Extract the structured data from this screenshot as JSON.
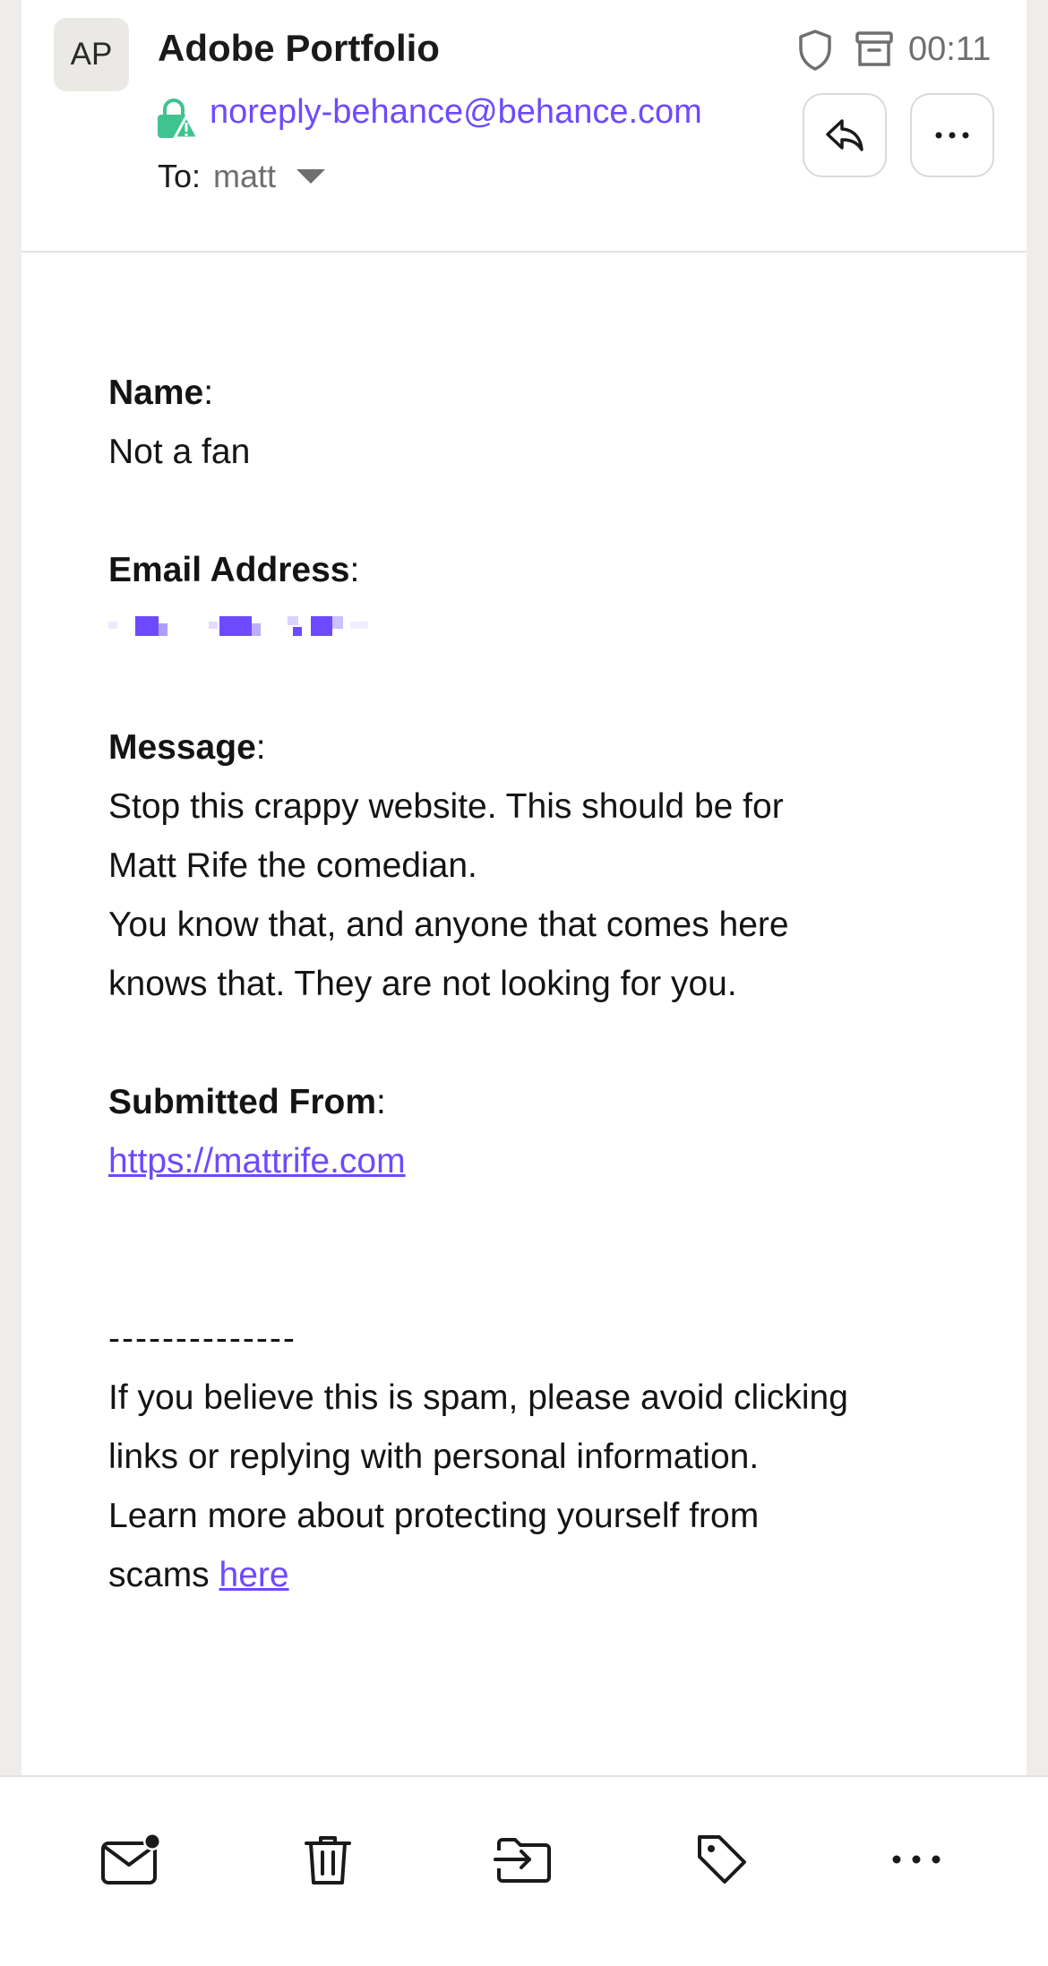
{
  "header": {
    "avatar_initials": "AP",
    "sender_name": "Adobe Portfolio",
    "sender_email": "noreply-behance@behance.com",
    "to_label": "To:",
    "recipient": "matt",
    "time": "00:11"
  },
  "message": {
    "name_label": "Name",
    "name_value": "Not a fan",
    "email_label": "Email Address",
    "message_label": "Message",
    "message_lines": [
      "Stop this crappy website. This should be for",
      "Matt Rife the comedian.",
      "You know that, and anyone that comes here",
      "knows that. They are not looking for you."
    ],
    "submitted_label": "Submitted From",
    "submitted_url": "https://mattrife.com",
    "separator": "--------------",
    "footer_lines": [
      "If you believe this is spam, please avoid clicking",
      "links or replying with personal information.",
      "Learn more about protecting yourself from"
    ],
    "footer_last_prefix": "scams ",
    "footer_link": "here",
    "colon": ":"
  },
  "icons": {
    "lock": "lock-warning-icon",
    "shield": "shield-icon",
    "archive": "archive-icon",
    "reply": "reply-icon",
    "more": "more-icon",
    "unread": "mark-unread-icon",
    "trash": "trash-icon",
    "move": "move-to-folder-icon",
    "label": "tag-icon"
  },
  "colors": {
    "accent": "#6d4aff",
    "lock_green": "#3fc38f"
  }
}
